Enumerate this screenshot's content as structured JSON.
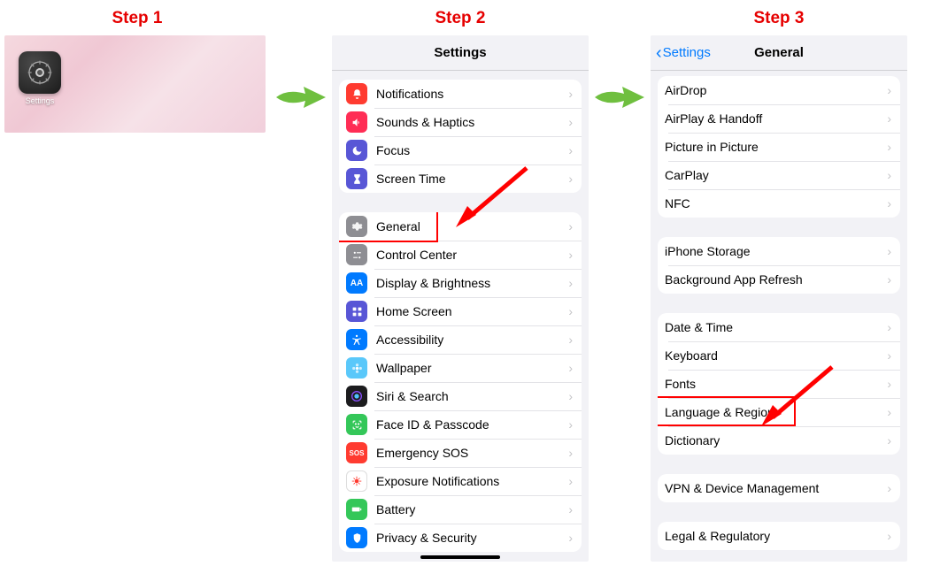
{
  "steps": {
    "s1": "Step 1",
    "s2": "Step 2",
    "s3": "Step 3"
  },
  "home": {
    "app_label": "Settings"
  },
  "screen2": {
    "title": "Settings",
    "group1": [
      {
        "label": "Notifications"
      },
      {
        "label": "Sounds & Haptics"
      },
      {
        "label": "Focus"
      },
      {
        "label": "Screen Time"
      }
    ],
    "group2": [
      {
        "label": "General"
      },
      {
        "label": "Control Center"
      },
      {
        "label": "Display & Brightness"
      },
      {
        "label": "Home Screen"
      },
      {
        "label": "Accessibility"
      },
      {
        "label": "Wallpaper"
      },
      {
        "label": "Siri & Search"
      },
      {
        "label": "Face ID & Passcode"
      },
      {
        "label": "Emergency SOS"
      },
      {
        "label": "Exposure Notifications"
      },
      {
        "label": "Battery"
      },
      {
        "label": "Privacy & Security"
      }
    ]
  },
  "screen3": {
    "back": "Settings",
    "title": "General",
    "group1": [
      {
        "label": "AirDrop"
      },
      {
        "label": "AirPlay & Handoff"
      },
      {
        "label": "Picture in Picture"
      },
      {
        "label": "CarPlay"
      },
      {
        "label": "NFC"
      }
    ],
    "group2": [
      {
        "label": "iPhone Storage"
      },
      {
        "label": "Background App Refresh"
      }
    ],
    "group3": [
      {
        "label": "Date & Time"
      },
      {
        "label": "Keyboard"
      },
      {
        "label": "Fonts"
      },
      {
        "label": "Language & Region"
      },
      {
        "label": "Dictionary"
      }
    ],
    "group4": [
      {
        "label": "VPN & Device Management"
      }
    ],
    "group5": [
      {
        "label": "Legal & Regulatory"
      }
    ]
  }
}
